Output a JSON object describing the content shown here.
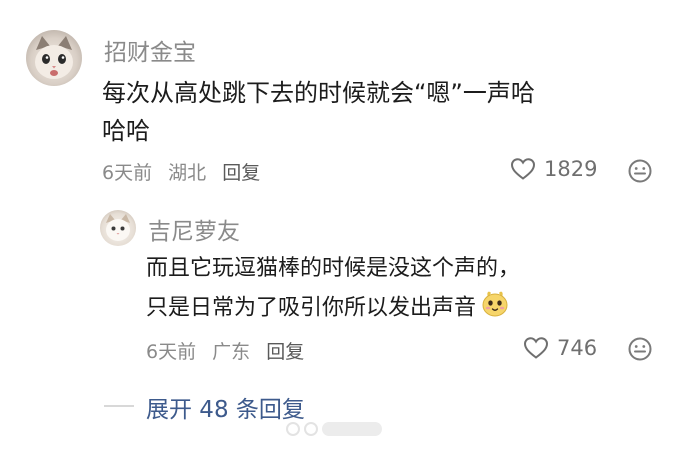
{
  "comment": {
    "username": "招财金宝",
    "text_line1": "每次从高处跳下去的时候就会“嗯”一声哈",
    "text_line2": "哈哈",
    "time": "6天前",
    "location": "湖北",
    "reply_label": "回复",
    "like_count": "1829",
    "avatar_icon": "cat-avatar-icon"
  },
  "reply": {
    "username": "吉尼萝友",
    "text_line1": "而且它玩逗猫棒的时候是没这个声的，",
    "text_line2": "只是日常为了吸引你所以发出声音",
    "time": "6天前",
    "location": "广东",
    "reply_label": "回复",
    "like_count": "746",
    "avatar_icon": "cat-avatar-icon",
    "inline_emoji": "cute-face-emoji"
  },
  "expand": {
    "label": "展开 48 条回复"
  },
  "colors": {
    "link": "#3d5a8c",
    "meta": "#8a8a8a",
    "text": "#1c1c1c"
  }
}
